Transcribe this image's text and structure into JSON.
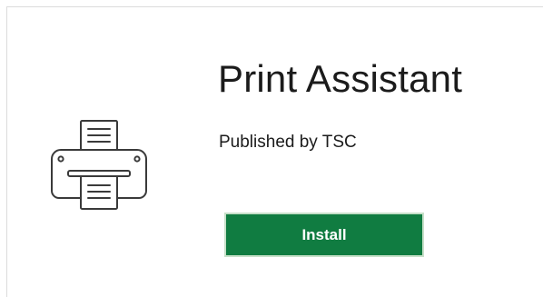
{
  "app": {
    "title": "Print Assistant",
    "publisher": "Published by TSC",
    "icon": "printer-icon"
  },
  "actions": {
    "install_label": "Install"
  },
  "colors": {
    "install_button_bg": "#107c41",
    "install_button_border": "#c7e0c9",
    "text": "#1b1b1b",
    "icon_stroke": "#3a3a3a"
  }
}
